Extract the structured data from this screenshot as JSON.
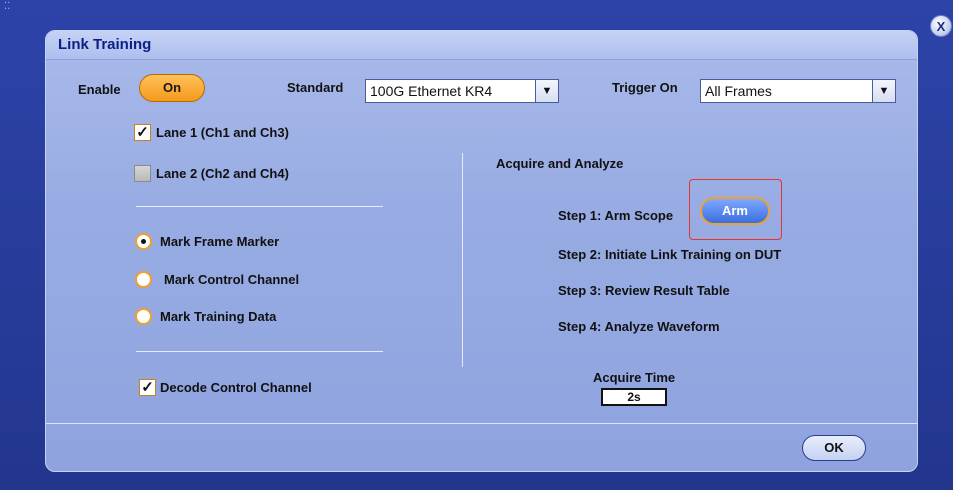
{
  "window": {
    "title": "Link Training",
    "close_label": "X"
  },
  "enable": {
    "label": "Enable",
    "button": "On"
  },
  "standard": {
    "label": "Standard",
    "value": "100G Ethernet KR4"
  },
  "trigger_on": {
    "label": "Trigger On",
    "value": "All Frames"
  },
  "lanes": [
    {
      "label": "Lane 1 (Ch1 and Ch3)",
      "checked": true
    },
    {
      "label": "Lane 2 (Ch2 and Ch4)",
      "checked": false
    }
  ],
  "marks": [
    {
      "label": "Mark Frame Marker",
      "selected": true
    },
    {
      "label": "Mark Control Channel",
      "selected": false
    },
    {
      "label": "Mark Training Data",
      "selected": false
    }
  ],
  "decode": {
    "label": "Decode Control Channel",
    "checked": true
  },
  "acquire": {
    "heading": "Acquire and Analyze",
    "step1": "Step 1: Arm Scope",
    "arm_button": "Arm",
    "step2": "Step 2: Initiate Link Training on DUT",
    "step3": "Step 3: Review Result Table",
    "step4": "Step 4: Analyze Waveform",
    "time_label": "Acquire Time",
    "time_value": "2s"
  },
  "ok_button": "OK",
  "checkmark": "✓"
}
